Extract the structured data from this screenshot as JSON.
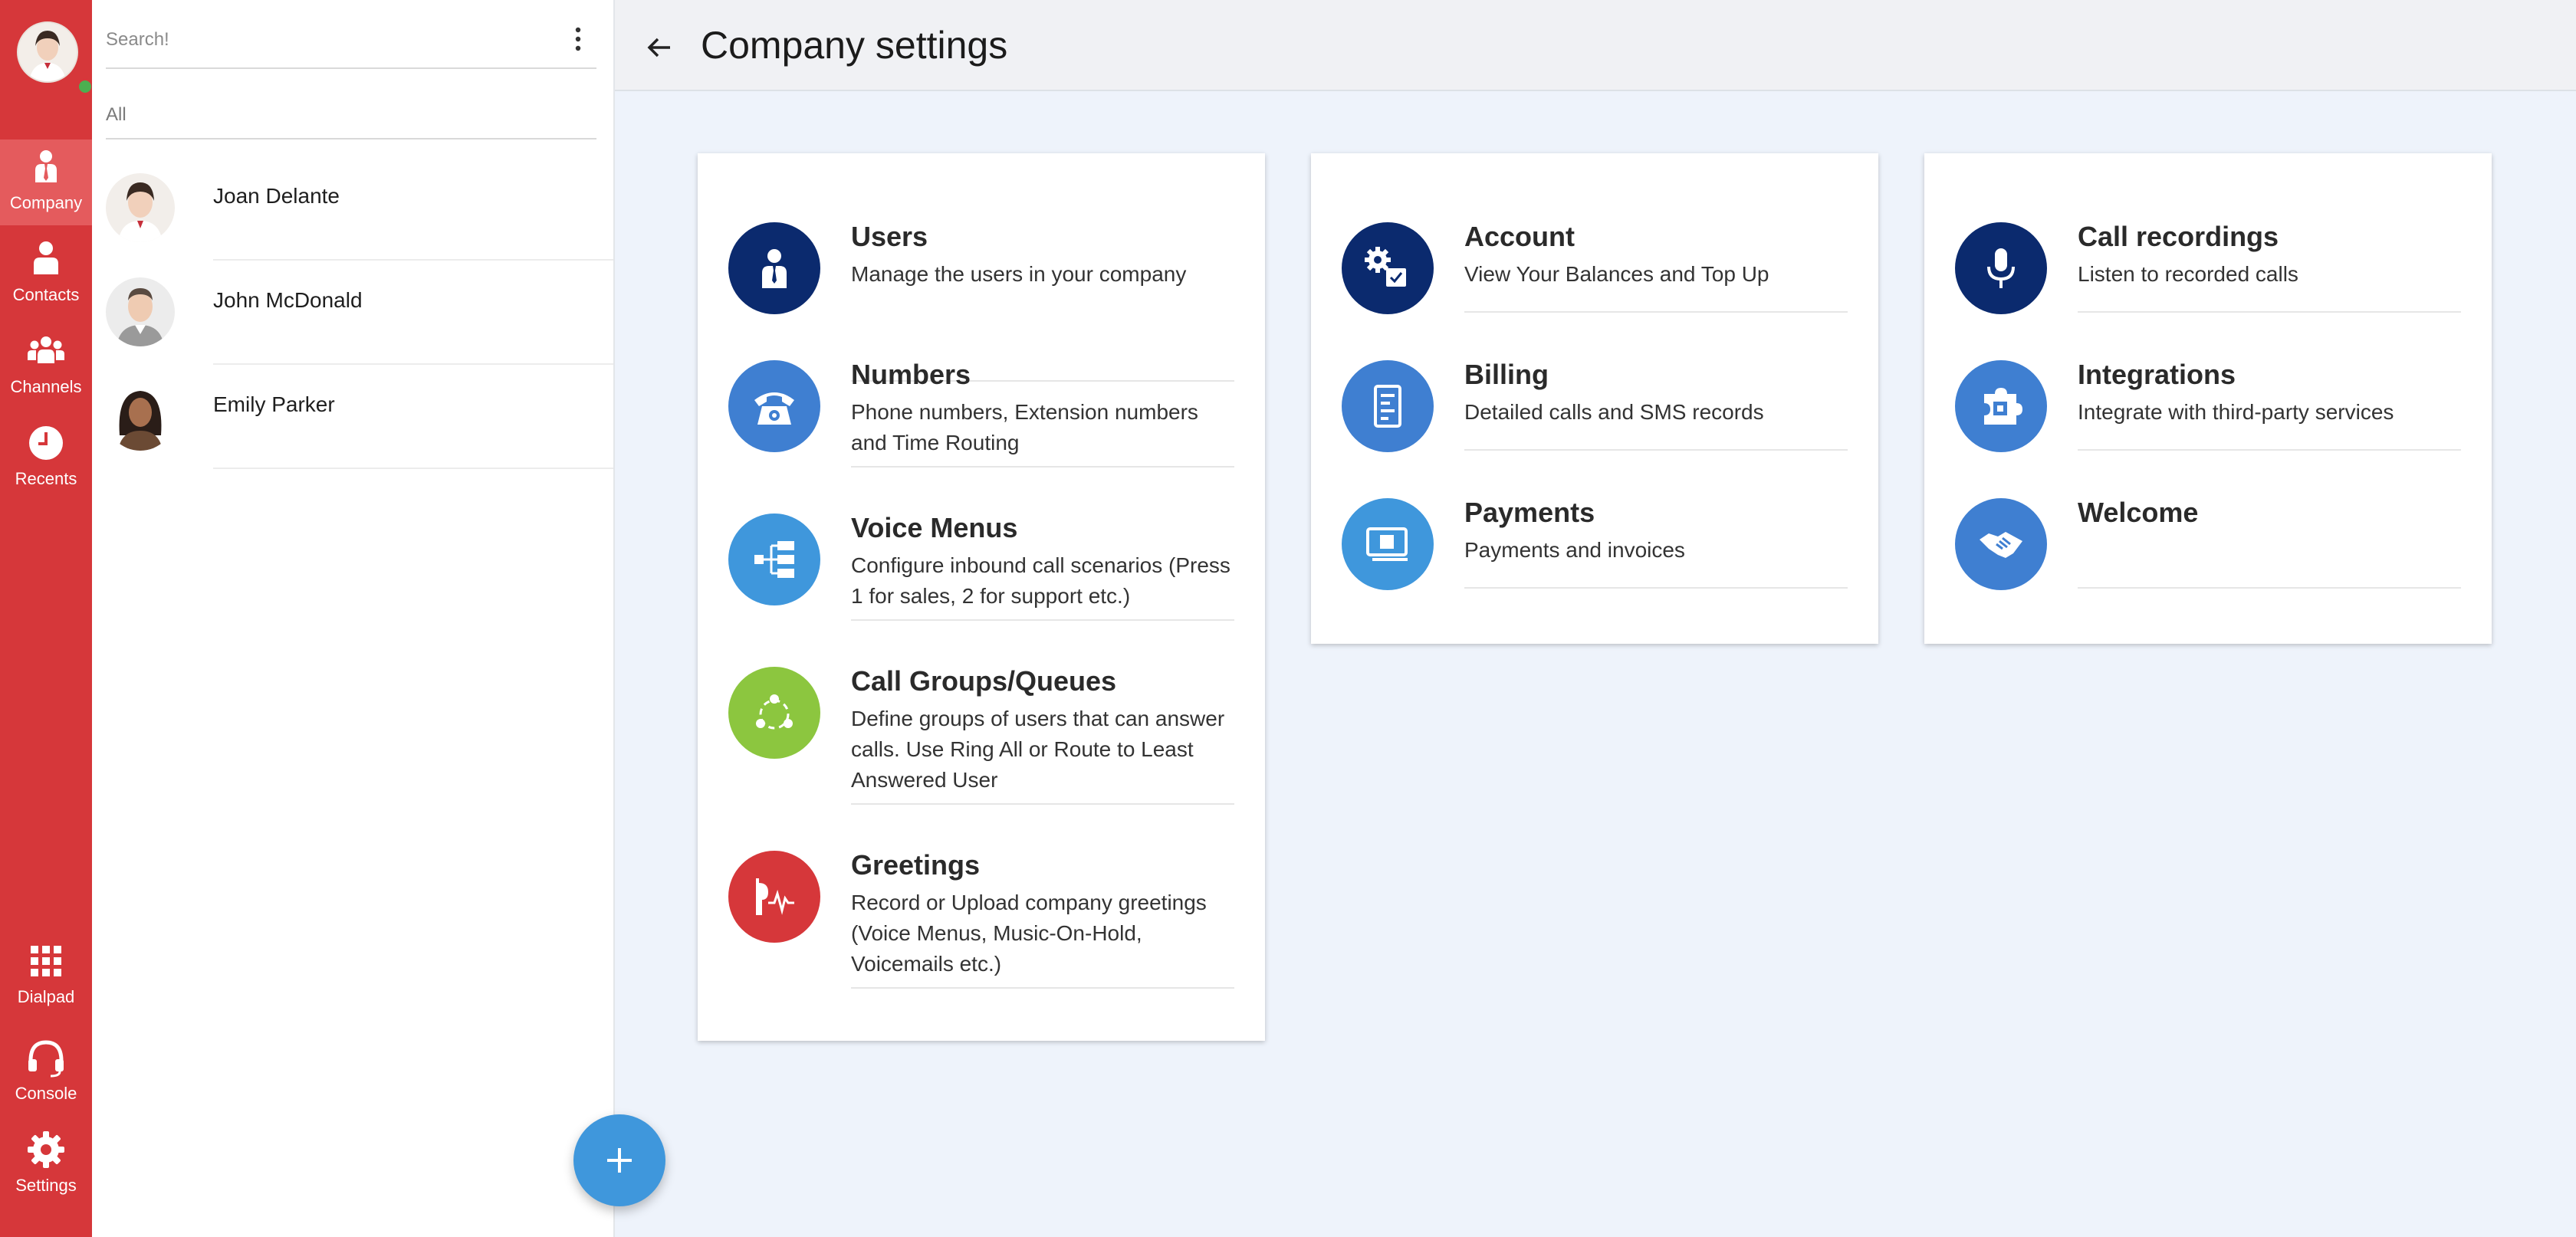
{
  "rail": {
    "items": [
      {
        "label": "Company",
        "icon": "company-icon",
        "active": true
      },
      {
        "label": "Contacts",
        "icon": "contacts-icon"
      },
      {
        "label": "Channels",
        "icon": "channels-icon"
      },
      {
        "label": "Recents",
        "icon": "recents-icon"
      },
      {
        "label": "Dialpad",
        "icon": "dialpad-icon"
      },
      {
        "label": "Console",
        "icon": "headset-icon"
      },
      {
        "label": "Settings",
        "icon": "gear-icon"
      }
    ],
    "color": "#d6373a",
    "active_color": "#e45b5d"
  },
  "contacts": {
    "search_placeholder": "Search!",
    "filter": "All",
    "items": [
      {
        "name": "Joan Delante"
      },
      {
        "name": "John McDonald"
      },
      {
        "name": "Emily Parker"
      }
    ]
  },
  "header": {
    "title": "Company settings"
  },
  "cards": [
    {
      "items": [
        {
          "title": "Users",
          "desc": "Manage the users in your company",
          "icon": "user-tie-icon",
          "color": "#0b2a6e"
        },
        {
          "title": "Numbers",
          "desc": "Phone numbers, Extension numbers and Time Routing",
          "icon": "telephone-icon",
          "color": "#3f7fd1"
        },
        {
          "title": "Voice Menus",
          "desc": "Configure inbound call scenarios (Press 1 for sales, 2 for support etc.)",
          "icon": "tree-menu-icon",
          "color": "#3f97dc"
        },
        {
          "title": "Call Groups/Queues",
          "desc": "Define groups of users that can answer calls. Use Ring All or Route to Least Answered User",
          "icon": "group-cycle-icon",
          "color": "#8cc63f"
        },
        {
          "title": "Greetings",
          "desc": "Record or Upload company greetings (Voice Menus, Music-On-Hold, Voicemails etc.)",
          "icon": "voice-wave-icon",
          "color": "#d6373a"
        }
      ]
    },
    {
      "items": [
        {
          "title": "Account",
          "desc": "View Your Balances and Top Up",
          "icon": "account-settings-icon",
          "color": "#0b2a6e"
        },
        {
          "title": "Billing",
          "desc": "Detailed calls and SMS records",
          "icon": "receipt-icon",
          "color": "#3f7fd1"
        },
        {
          "title": "Payments",
          "desc": "Payments and invoices",
          "icon": "payment-icon",
          "color": "#3f97dc"
        }
      ]
    },
    {
      "items": [
        {
          "title": "Call recordings",
          "desc": "Listen to recorded calls",
          "icon": "microphone-icon",
          "color": "#0b2a6e"
        },
        {
          "title": "Integrations",
          "desc": "Integrate with third-party services",
          "icon": "puzzle-icon",
          "color": "#3f7fd1"
        },
        {
          "title": "Welcome",
          "desc": "",
          "icon": "handshake-icon",
          "color": "#3f7fd1"
        }
      ]
    }
  ]
}
